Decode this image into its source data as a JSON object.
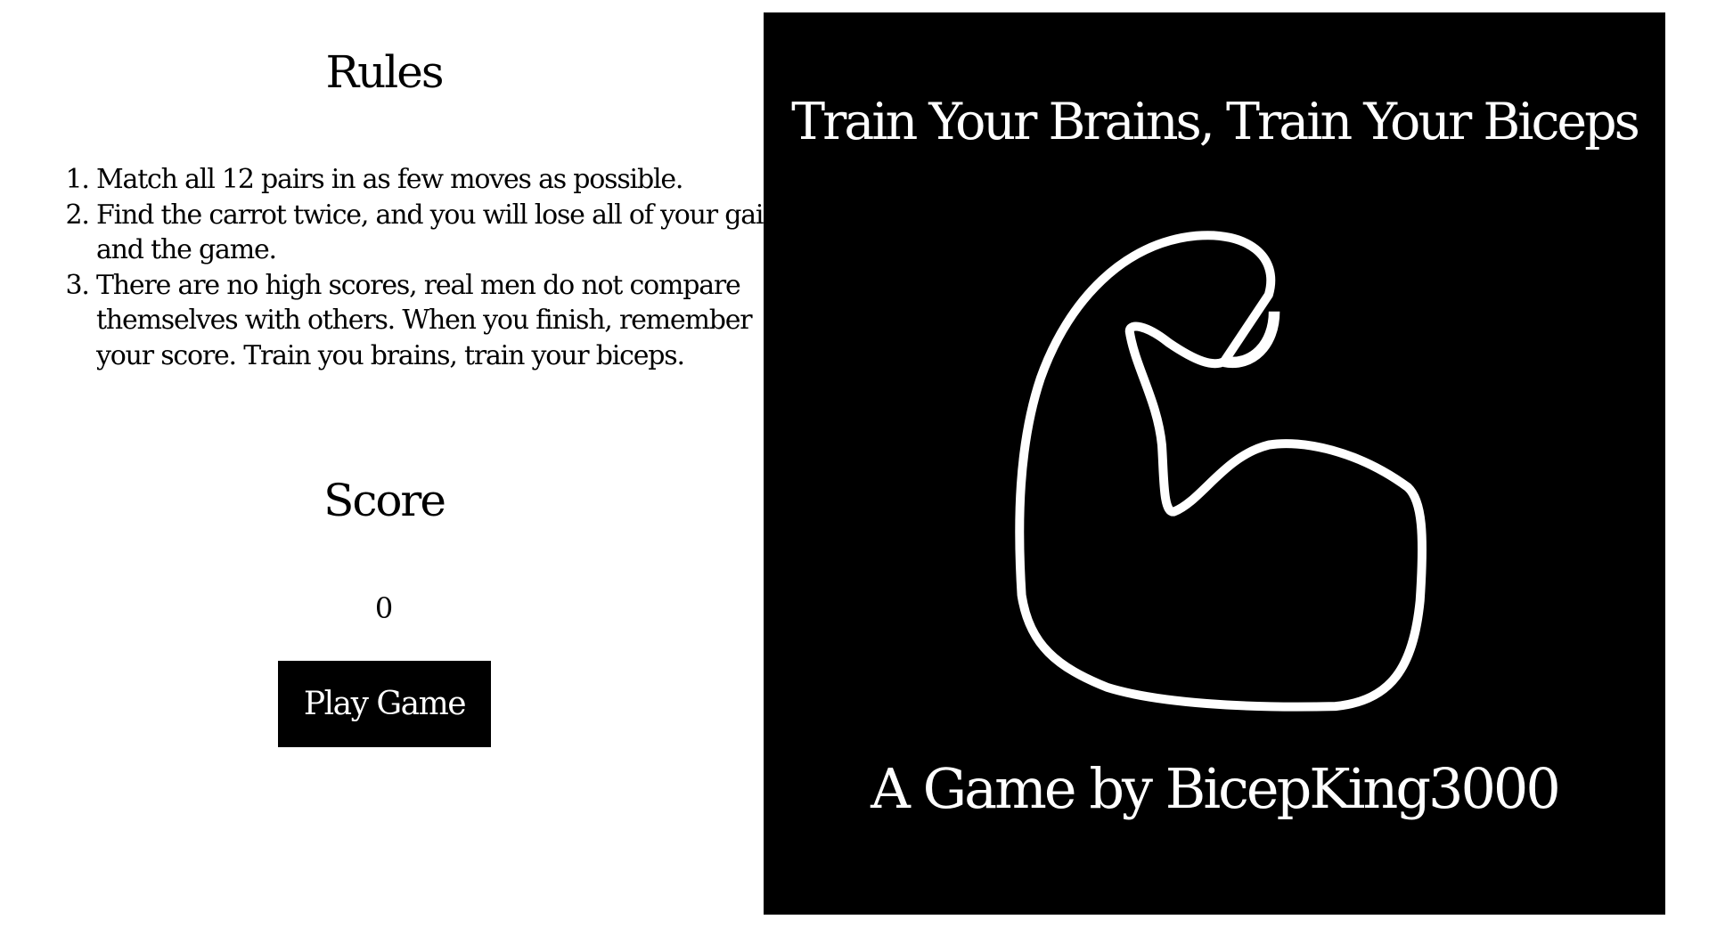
{
  "rules": {
    "title": "Rules",
    "items": [
      "Match all 12 pairs in as few moves as possible.",
      "Find the carrot twice, and you will lose all of your gains, and the game.",
      "There are no high scores, real men do not compare themselves with others. When you finish, remember your score. Train you brains, train your biceps."
    ]
  },
  "score": {
    "title": "Score",
    "value": "0"
  },
  "play_button": "Play Game",
  "panel": {
    "title": "Train Your Brains, Train Your Biceps",
    "byline": "A Game by BicepKing3000",
    "icon": "flexed-bicep-icon"
  }
}
